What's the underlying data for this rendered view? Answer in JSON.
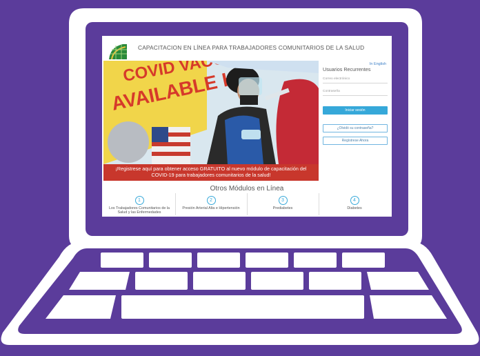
{
  "site": {
    "title": "CAPACITACION EN LÍNEA PARA TRABAJADORES COMUNITARIOS DE LA SALUD",
    "language_link": "In English"
  },
  "hero": {
    "banner_line1": "¡Registrese aquí para obtener acceso GRATUITO al nuevo módulo de capacitación del",
    "banner_line2": "COVID-19 para trabajadores comunitarios de la salud!",
    "sign_text_1": "COVID VACCINE",
    "sign_text_2": "AVAILABLE H"
  },
  "sidebar": {
    "heading": "Usuarios Recurrentes",
    "email_placeholder": "Correo electrónico",
    "password_placeholder": "Contraseña",
    "login_button": "Iniciar sesión",
    "forgot_button": "¿Olvidó su contraseña?",
    "register_button": "Regístrese Ahora"
  },
  "modules": {
    "title": "Otros Módulos en Línea",
    "items": [
      {
        "number": "1",
        "label": "Los Trabajadores Comunitarios de la Salud y las Enfermedades"
      },
      {
        "number": "2",
        "label": "Presión Arterial Alta e Hipertensión"
      },
      {
        "number": "3",
        "label": "Prediabetes"
      },
      {
        "number": "4",
        "label": "Diabetes"
      }
    ]
  },
  "colors": {
    "background": "#5b3c9b",
    "banner": "#c8372c",
    "accent": "#36a8d9"
  }
}
